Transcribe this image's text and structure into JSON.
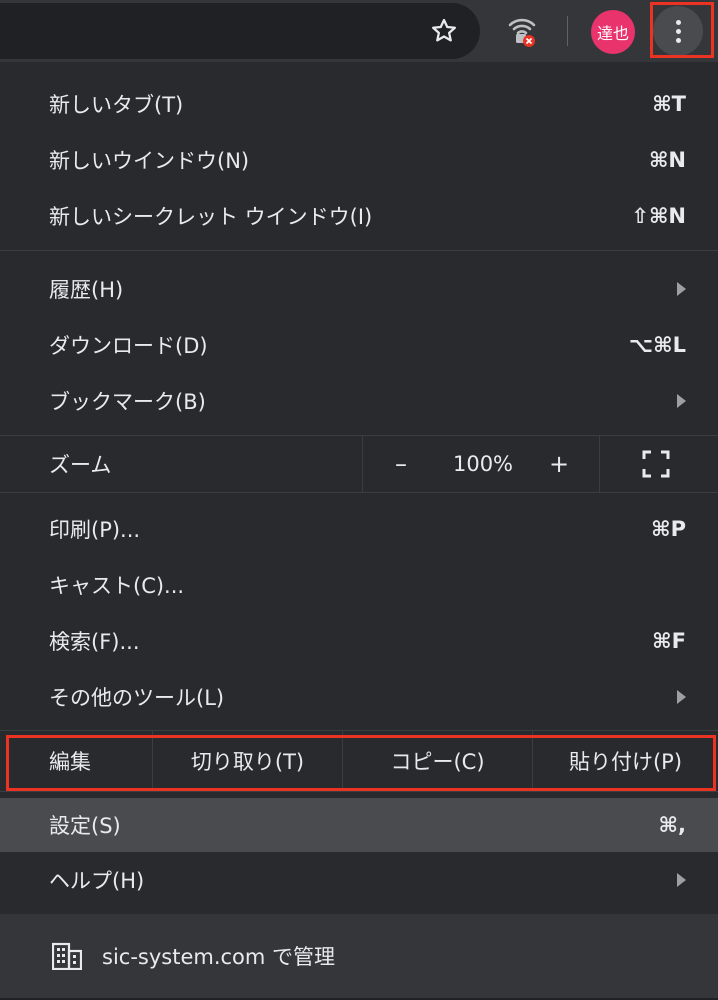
{
  "toolbar": {
    "avatar_label": "達也",
    "icons": {
      "bookmark": "star-icon",
      "extension": "wifi-lock-icon",
      "menu": "more-vert-icon"
    }
  },
  "menu": {
    "new_tab": {
      "label": "新しいタブ(T)",
      "shortcut": "⌘T"
    },
    "new_window": {
      "label": "新しいウインドウ(N)",
      "shortcut": "⌘N"
    },
    "incognito": {
      "label": "新しいシークレット ウインドウ(I)",
      "shortcut": "⇧⌘N"
    },
    "history": {
      "label": "履歴(H)"
    },
    "downloads": {
      "label": "ダウンロード(D)",
      "shortcut": "⌥⌘L"
    },
    "bookmarks": {
      "label": "ブックマーク(B)"
    },
    "zoom": {
      "label": "ズーム",
      "minus": "–",
      "value": "100%",
      "plus": "+"
    },
    "print": {
      "label": "印刷(P)...",
      "shortcut": "⌘P"
    },
    "cast": {
      "label": "キャスト(C)..."
    },
    "find": {
      "label": "検索(F)...",
      "shortcut": "⌘F"
    },
    "more_tools": {
      "label": "その他のツール(L)"
    },
    "edit": {
      "label": "編集",
      "cut": "切り取り(T)",
      "copy": "コピー(C)",
      "paste": "貼り付け(P)"
    },
    "settings": {
      "label": "設定(S)",
      "shortcut": "⌘,"
    },
    "help": {
      "label": "ヘルプ(H)"
    },
    "managed": {
      "label": "sic-system.com で管理"
    }
  },
  "colors": {
    "highlight_border": "#ea3323",
    "avatar_bg": "#e8336d",
    "menu_bg": "#292a2d",
    "selected_bg": "#4a4b4f"
  }
}
